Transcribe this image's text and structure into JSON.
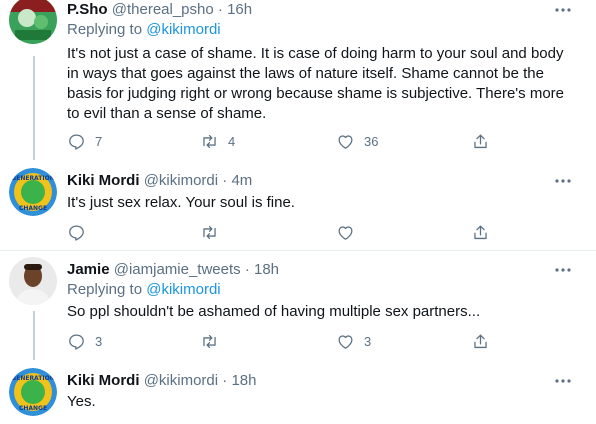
{
  "colors": {
    "link": "#1b95e0",
    "muted": "#5b7083",
    "text": "#0f1419",
    "divider": "#e6ecf0"
  },
  "tweets": [
    {
      "name": "P.Sho",
      "handle": "@thereal_psho",
      "dot": "·",
      "time": "16h",
      "replying_prefix": "Replying to",
      "replying_to": "@kikimordi",
      "text": "It's not just a case of shame. It is case of doing harm to your soul and body in ways that goes against the laws of nature itself. Shame cannot be the basis for judging right or wrong because shame is subjective. There's more to evil than a sense of shame.",
      "replies": "7",
      "retweets": "4",
      "likes": "36"
    },
    {
      "name": "Kiki Mordi",
      "handle": "@kikimordi",
      "dot": "·",
      "time": "4m",
      "text": "It's just sex relax. Your soul is fine.",
      "replies": "",
      "retweets": "",
      "likes": "",
      "logo_top": "GENERATION",
      "logo_bottom": "CHANGE"
    },
    {
      "name": "Jamie",
      "handle": "@iamjamie_tweets",
      "dot": "·",
      "time": "18h",
      "replying_prefix": "Replying to",
      "replying_to": "@kikimordi",
      "text": "So ppl shouldn't be ashamed of having multiple sex partners...",
      "replies": "3",
      "retweets": "",
      "likes": "3"
    },
    {
      "name": "Kiki Mordi",
      "handle": "@kikimordi",
      "dot": "·",
      "time": "18h",
      "text": "Yes.",
      "logo_top": "GENERATION",
      "logo_bottom": "CHANGE"
    }
  ]
}
